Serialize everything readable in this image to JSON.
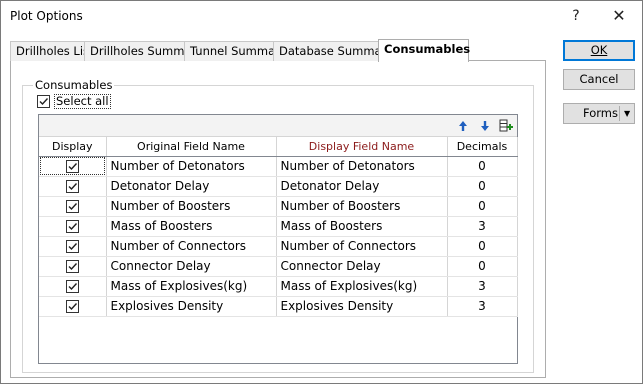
{
  "window": {
    "title": "Plot Options",
    "help_glyph": "?",
    "close_glyph": "✕"
  },
  "tabs": [
    {
      "label": "Drillholes List",
      "active": false
    },
    {
      "label": "Drillholes Summary",
      "active": false
    },
    {
      "label": "Tunnel Summary",
      "active": false
    },
    {
      "label": "Database Summary",
      "active": false
    },
    {
      "label": "Consumables",
      "active": true
    }
  ],
  "group": {
    "label": "Consumables",
    "select_all_label": "Select all",
    "select_all_checked": true
  },
  "grid": {
    "toolbar_icons": [
      "move-up-icon",
      "move-down-icon",
      "add-fields-icon"
    ],
    "columns": [
      "Display",
      "Original Field Name",
      "Display Field Name",
      "Decimals"
    ],
    "rows": [
      {
        "display": true,
        "original": "Number of Detonators",
        "display_name": "Number of Detonators",
        "decimals": "0"
      },
      {
        "display": true,
        "original": "Detonator Delay",
        "display_name": "Detonator Delay",
        "decimals": "0"
      },
      {
        "display": true,
        "original": "Number of Boosters",
        "display_name": "Number of Boosters",
        "decimals": "0"
      },
      {
        "display": true,
        "original": "Mass of Boosters",
        "display_name": "Mass of Boosters",
        "decimals": "3"
      },
      {
        "display": true,
        "original": "Number of Connectors",
        "display_name": "Number of Connectors",
        "decimals": "0"
      },
      {
        "display": true,
        "original": "Connector Delay",
        "display_name": "Connector Delay",
        "decimals": "0"
      },
      {
        "display": true,
        "original": "Mass of Explosives(kg)",
        "display_name": "Mass of Explosives(kg)",
        "decimals": "3"
      },
      {
        "display": true,
        "original": "Explosives Density",
        "display_name": "Explosives Density",
        "decimals": "3"
      }
    ]
  },
  "buttons": {
    "ok_label": "OK",
    "cancel_label": "Cancel",
    "forms_label": "Forms",
    "forms_arrow": "▼"
  },
  "colors": {
    "accent": "#0078d7",
    "display_header": "#8b1a1a",
    "add_icon_green": "#1e8c1e",
    "arrow_blue": "#1f5fbf"
  }
}
